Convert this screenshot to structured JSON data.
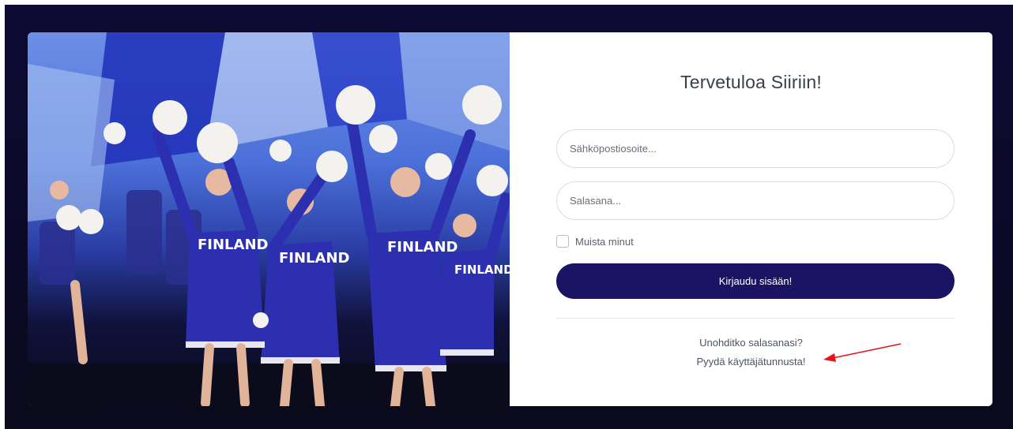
{
  "login": {
    "title": "Tervetuloa Siiriin!",
    "email_placeholder": "Sähköpostiosoite...",
    "password_placeholder": "Salasana...",
    "remember_label": "Muista minut",
    "submit_label": "Kirjaudu sisään!",
    "forgot_link": "Unohditko salasanasi?",
    "request_link": "Pyydä käyttäjätunnusta!"
  },
  "hero": {
    "uniform_text": "FINLAND"
  },
  "colors": {
    "page_background": "#0d0a33",
    "button": "#1b1464",
    "annotation_arrow": "#e8141b"
  }
}
